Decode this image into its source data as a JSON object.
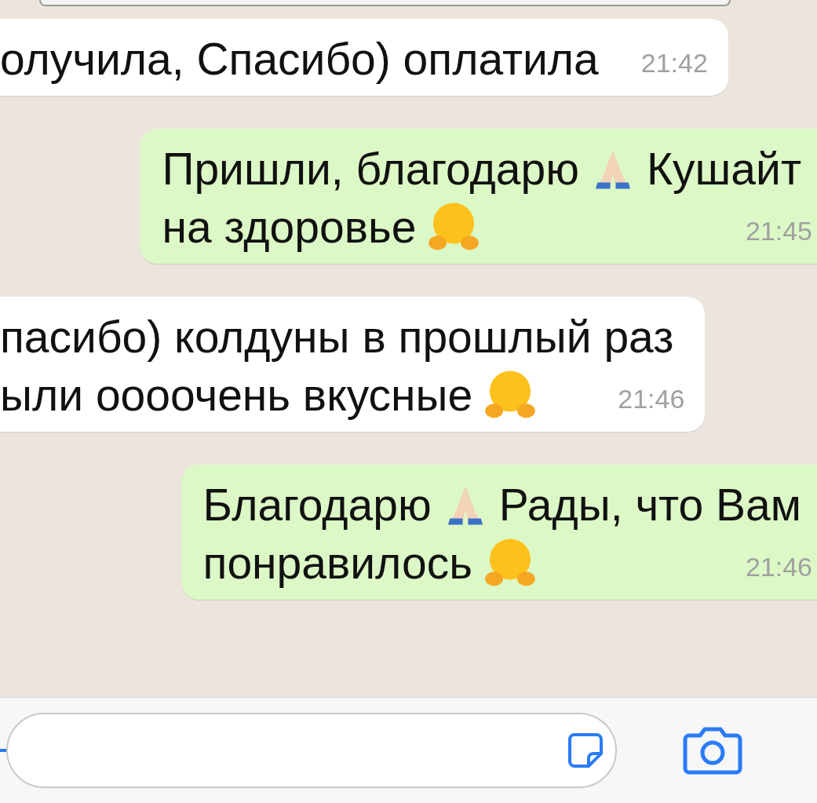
{
  "messages": [
    {
      "kind": "incoming",
      "lines": [
        [
          {
            "kind": "text",
            "text": "олучила, Спасибо) оплатила"
          }
        ]
      ],
      "time": "21:42"
    },
    {
      "kind": "outgoing",
      "lines": [
        [
          {
            "kind": "text",
            "text": "Пришли, благодарю"
          },
          {
            "kind": "pray"
          },
          {
            "kind": "text",
            "text": "Кушайт"
          }
        ],
        [
          {
            "kind": "text",
            "text": "на здоровье"
          },
          {
            "kind": "hug"
          }
        ]
      ],
      "time": "21:45"
    },
    {
      "kind": "incoming",
      "lines": [
        [
          {
            "kind": "text",
            "text": "пасибо) колдуны в прошлый раз"
          }
        ],
        [
          {
            "kind": "text",
            "text": "ыли оооочень вкусные"
          },
          {
            "kind": "hug"
          }
        ]
      ],
      "time": "21:46"
    },
    {
      "kind": "outgoing",
      "lines": [
        [
          {
            "kind": "text",
            "text": "Благодарю"
          },
          {
            "kind": "pray"
          },
          {
            "kind": "text",
            "text": "Рады, что Вам"
          }
        ],
        [
          {
            "kind": "text",
            "text": "понравилось"
          },
          {
            "kind": "hug"
          }
        ]
      ],
      "time": "21:46"
    }
  ]
}
